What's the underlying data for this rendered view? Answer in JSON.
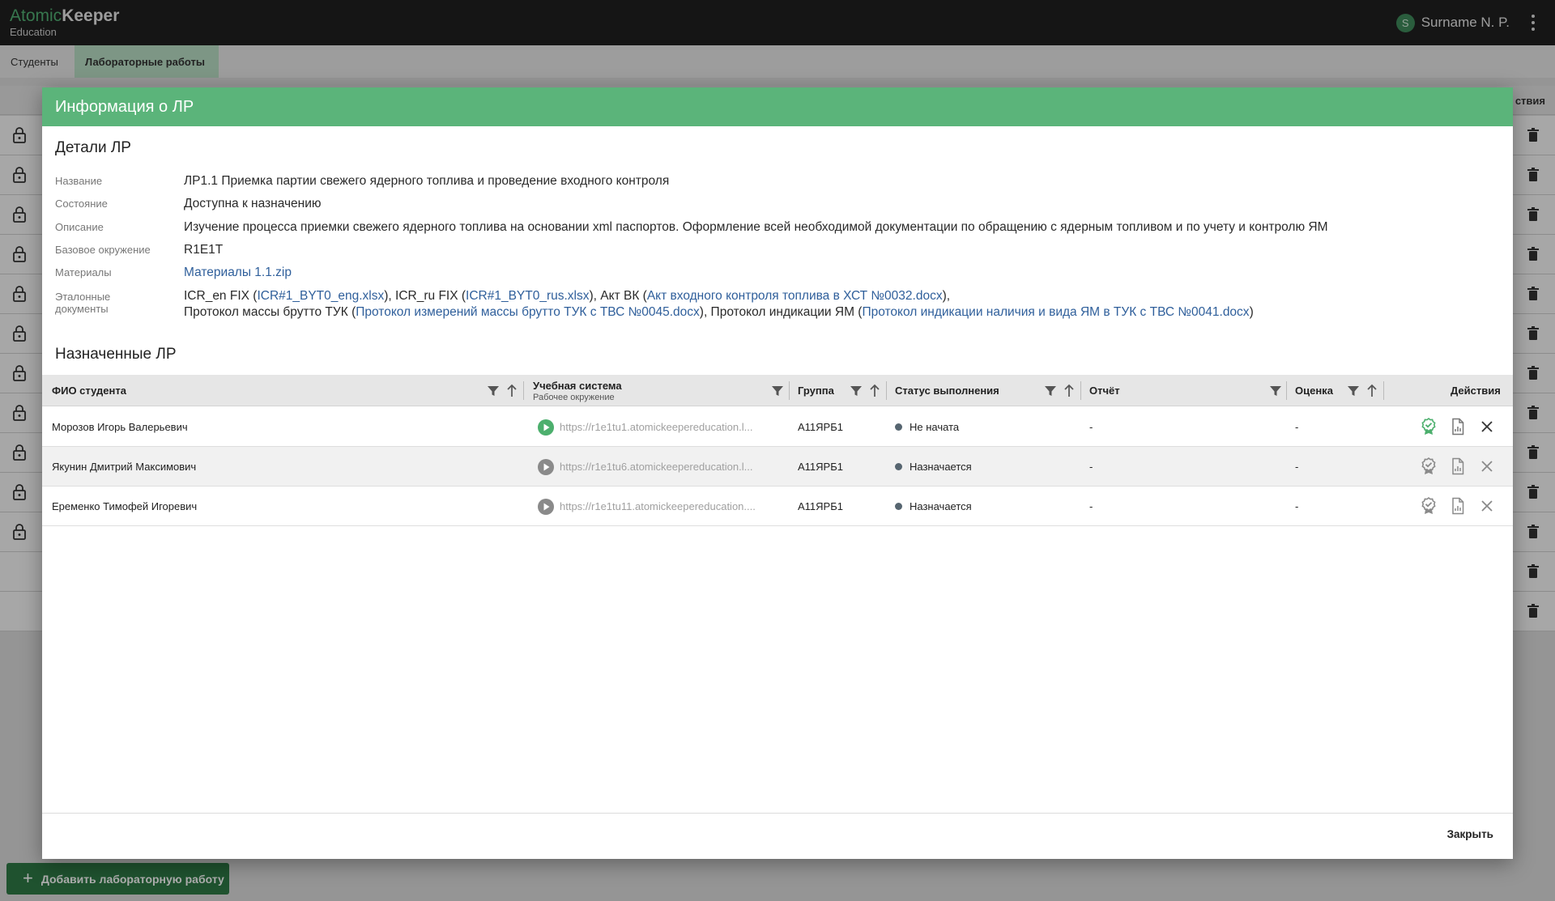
{
  "app": {
    "logo_part1": "Atomic",
    "logo_part2": "Keeper",
    "logo_sub": "Education",
    "user_initial": "S",
    "user_name": "Surname N. P."
  },
  "tabs": [
    {
      "label": "Студенты",
      "active": false
    },
    {
      "label": "Лабораторные работы",
      "active": true
    }
  ],
  "background": {
    "actions_header": "ствия",
    "add_button": "Добавить лабораторную работу"
  },
  "modal": {
    "title": "Информация о ЛР",
    "details_title": "Детали ЛР",
    "details": {
      "name_label": "Название",
      "name_value": "ЛР1.1 Приемка партии свежего ядерного топлива и проведение входного контроля",
      "state_label": "Состояние",
      "state_value": "Доступна к назначению",
      "desc_label": "Описание",
      "desc_value": "Изучение процесса приемки свежего ядерного топлива на основании xml паспортов. Оформление всей необходимой документации по обращению с ядерным топливом и по учету и контролю ЯМ",
      "env_label": "Базовое окружение",
      "env_value": "R1E1T",
      "materials_label": "Материалы",
      "materials_link": "Материалы 1.1.zip",
      "refdocs_label_1": "Эталонные",
      "refdocs_label_2": "документы",
      "ref": {
        "t1": "ICR_en FIX (",
        "l1": "ICR#1_BYT0_eng.xlsx",
        "t2": "), ICR_ru FIX (",
        "l2": "ICR#1_BYT0_rus.xlsx",
        "t3": "), Акт ВК (",
        "l3": "Акт входного контроля топлива в ХСТ №0032.docx",
        "t4": "),",
        "t5": "Протокол массы брутто ТУК (",
        "l4": "Протокол измерений массы брутто ТУК с ТВС №0045.docx",
        "t6": "), Протокол индикации ЯМ (",
        "l5": "Протокол индикации наличия и вида ЯМ в ТУК с ТВС №0041.docx",
        "t7": ")"
      }
    },
    "assigned_title": "Назначенные ЛР",
    "table": {
      "headers": {
        "student": "ФИО студента",
        "system": "Учебная система",
        "system_sub": "Рабочее окружение",
        "group": "Группа",
        "status": "Статус выполнения",
        "report": "Отчёт",
        "grade": "Оценка",
        "actions": "Действия"
      },
      "rows": [
        {
          "student": "Морозов Игорь Валерьевич",
          "url": "https://r1e1tu1.atomickeepereducation.l...",
          "group": "А11ЯРБ1",
          "status": "Не начата",
          "report": "-",
          "grade": "-",
          "running": true
        },
        {
          "student": "Якунин Дмитрий Максимович",
          "url": "https://r1e1tu6.atomickeepereducation.l...",
          "group": "А11ЯРБ1",
          "status": "Назначается",
          "report": "-",
          "grade": "-",
          "running": false
        },
        {
          "student": "Еременко Тимофей Игоревич",
          "url": "https://r1e1tu11.atomickeepereducation....",
          "group": "А11ЯРБ1",
          "status": "Назначается",
          "report": "-",
          "grade": "-",
          "running": false
        }
      ]
    },
    "close_button": "Закрыть"
  },
  "colors": {
    "accent_green": "#5bb47a",
    "header_dark": "#1f1f1f",
    "link_blue": "#2f5f9b",
    "status_dot": "#566570"
  }
}
